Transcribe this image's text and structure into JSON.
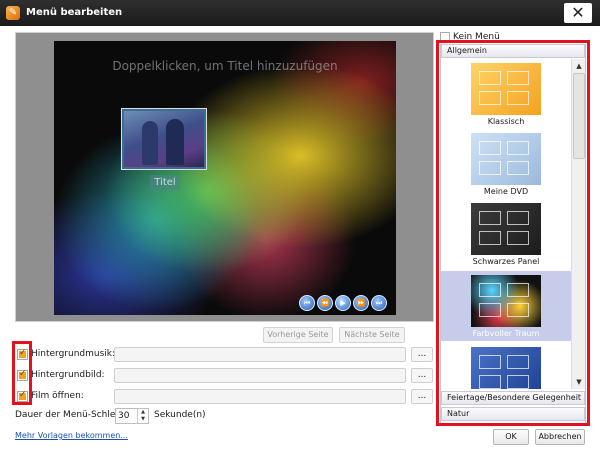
{
  "window": {
    "title": "Menü bearbeiten",
    "close_glyph": "✕",
    "icon": "app-icon"
  },
  "preview": {
    "hint": "Doppelklicken, um Titel hinzuzufügen",
    "caption": "Titel",
    "transport": [
      "⏮",
      "⏪",
      "▶",
      "⏩",
      "⏭"
    ]
  },
  "paging": {
    "prev": "Vorherige Seite",
    "next": "Nächste Seite"
  },
  "options": [
    {
      "label": "Hintergrundmusik:",
      "checked": true,
      "value": "",
      "browse": "..."
    },
    {
      "label": "Hintergrundbild:",
      "checked": true,
      "value": "",
      "browse": "..."
    },
    {
      "label": "Film öffnen:",
      "checked": true,
      "value": "",
      "browse": "..."
    }
  ],
  "loop": {
    "label": "Dauer der Menü-Schleife:",
    "value": "30",
    "unit": "Sekunde(n)"
  },
  "more_link": "Mehr Vorlagen bekommen...",
  "no_menu": {
    "label": "Kein Menü",
    "checked": false
  },
  "categories": {
    "top": "Allgemein",
    "bottom": [
      "Feiertage/Besondere Gelegenheit",
      "Natur"
    ]
  },
  "templates": [
    {
      "name": "Klassisch",
      "selected": false
    },
    {
      "name": "Meine DVD",
      "selected": false
    },
    {
      "name": "Schwarzes Panel",
      "selected": false
    },
    {
      "name": "Farbvoller Traum",
      "selected": true
    },
    {
      "name": "",
      "selected": false
    }
  ],
  "buttons": {
    "ok": "OK",
    "cancel": "Abbrechen"
  },
  "colors": {
    "accent": "#f2a31c",
    "highlight_box": "#e3121f",
    "selection": "#c7ccea",
    "link": "#1c4fb0"
  }
}
